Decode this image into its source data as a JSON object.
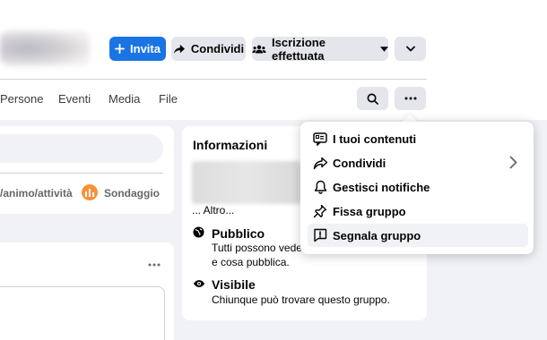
{
  "header": {
    "buttons": {
      "invite": "Invita",
      "share": "Condividi",
      "subscribed": "Iscrizione effettuata"
    }
  },
  "tabs": [
    "Persone",
    "Eventi",
    "Media",
    "File"
  ],
  "composer": {
    "feeling_activity": "/animo/attività",
    "poll": "Sondaggio"
  },
  "info": {
    "title": "Informazioni",
    "more": "... Altro...",
    "public_label": "Pubblico",
    "public_desc_1": "Tutti possono veder",
    "public_desc_2": "e cosa pubblica.",
    "visible_label": "Visibile",
    "visible_desc": "Chiunque può trovare questo gruppo."
  },
  "menu": {
    "items": [
      {
        "label": "I tuoi contenuti",
        "icon": "content-icon"
      },
      {
        "label": "Condividi",
        "icon": "share-icon"
      },
      {
        "label": "Gestisci notifiche",
        "icon": "bell-icon"
      },
      {
        "label": "Fissa gruppo",
        "icon": "pin-icon"
      },
      {
        "label": "Segnala gruppo",
        "icon": "report-icon"
      }
    ]
  },
  "colors": {
    "accent": "#1b74e4",
    "background": "#f0f2f5",
    "poll_orange": "#f7923a"
  }
}
